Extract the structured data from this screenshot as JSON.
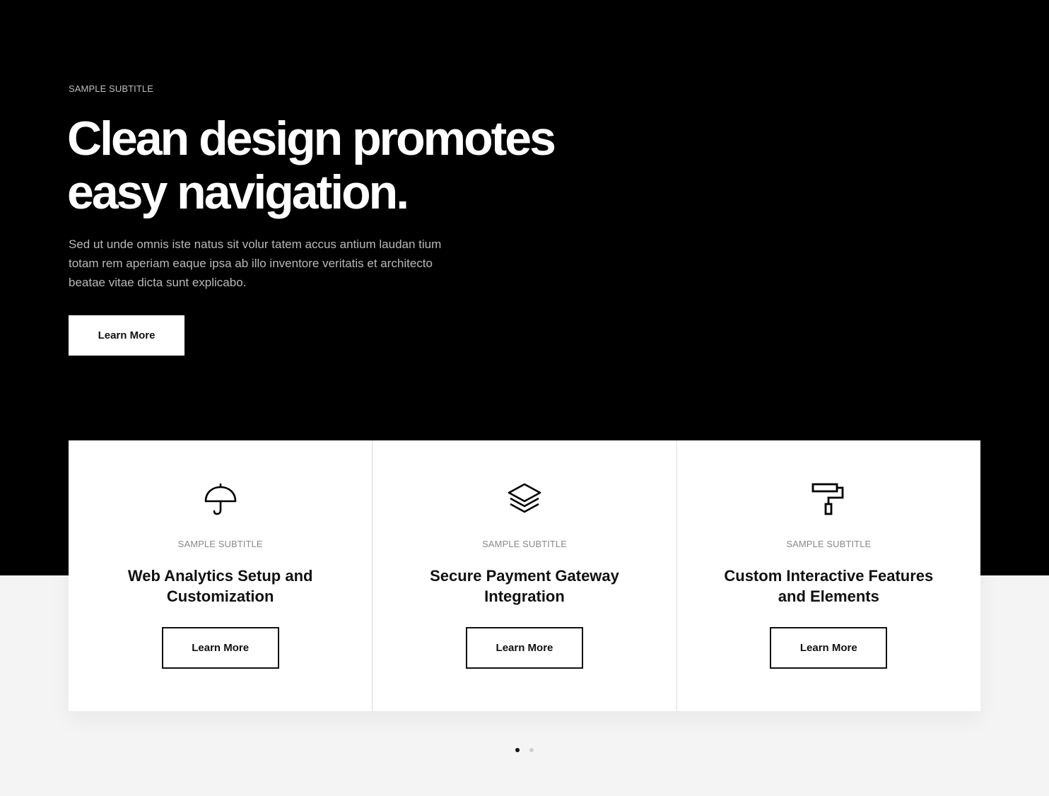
{
  "hero": {
    "subtitle": "SAMPLE SUBTITLE",
    "title_line1": "Clean design promotes",
    "title_line2": "easy navigation.",
    "description": "Sed ut unde omnis iste natus sit volur tatem accus antium laudan tium totam rem aperiam eaque ipsa ab illo inventore veritatis et architecto beatae vitae dicta sunt explicabo.",
    "button_label": "Learn More"
  },
  "cards": [
    {
      "icon": "umbrella-icon",
      "subtitle": "SAMPLE SUBTITLE",
      "title": "Web Analytics Setup and Customization",
      "button_label": "Learn More"
    },
    {
      "icon": "layers-icon",
      "subtitle": "SAMPLE SUBTITLE",
      "title": "Secure Payment Gateway Integration",
      "button_label": "Learn More"
    },
    {
      "icon": "paint-roller-icon",
      "subtitle": "SAMPLE SUBTITLE",
      "title": "Custom Interactive Features and Elements",
      "button_label": "Learn More"
    }
  ],
  "carousel": {
    "page_count": 2,
    "active_index": 0
  },
  "colors": {
    "hero_background": "#000000",
    "page_background": "#f4f4f4",
    "card_background": "#ffffff",
    "accent": "#111111"
  }
}
